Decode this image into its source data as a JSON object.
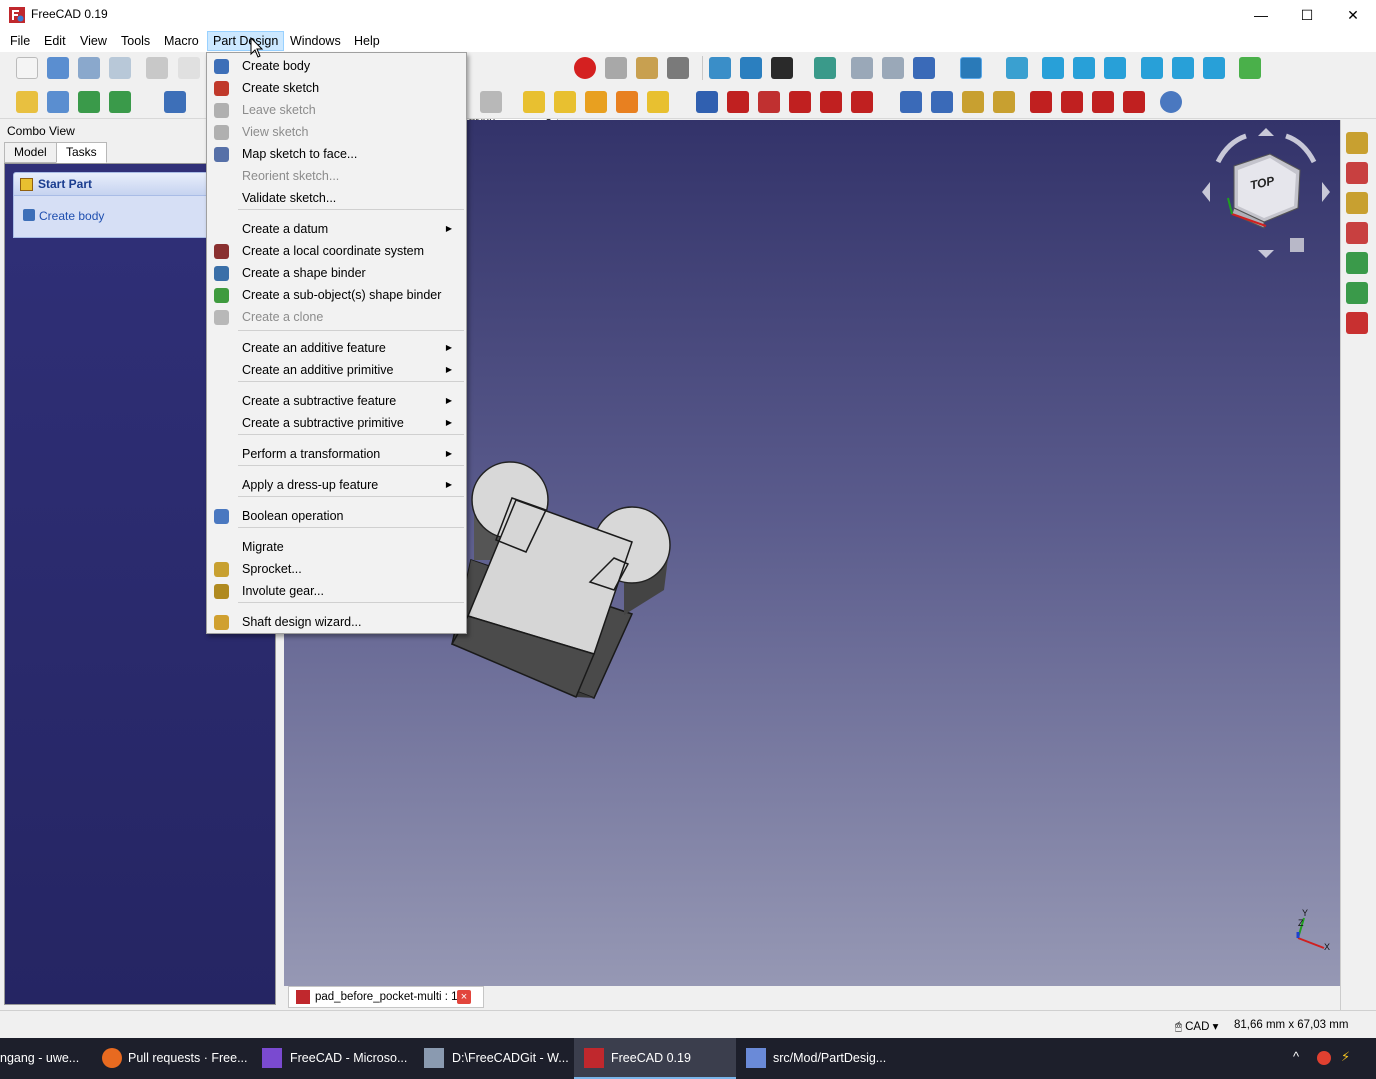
{
  "window": {
    "title": "FreeCAD 0.19"
  },
  "window_controls": {
    "minimize": "—",
    "maximize": "☐",
    "close": "✕"
  },
  "menubar": [
    "File",
    "Edit",
    "View",
    "Tools",
    "Macro",
    "Part Design",
    "Windows",
    "Help"
  ],
  "workbench_selector": {
    "value": "esign"
  },
  "combo_view": {
    "title": "Combo View",
    "tabs": [
      "Model",
      "Tasks"
    ],
    "task_box": {
      "title": "Start Part",
      "link": "Create body"
    }
  },
  "part_design_menu": {
    "items": [
      {
        "label": "Create body",
        "icon": "body-icon",
        "color": "#3d6fb8",
        "enabled": true,
        "submenu": false
      },
      {
        "label": "Create sketch",
        "icon": "sketch-icon",
        "color": "#c0392b",
        "enabled": true,
        "submenu": false
      },
      {
        "label": "Leave sketch",
        "icon": "leave-sketch-icon",
        "color": "#b0b0b0",
        "enabled": false,
        "submenu": false
      },
      {
        "label": "View sketch",
        "icon": "view-sketch-icon",
        "color": "#b0b0b0",
        "enabled": false,
        "submenu": false
      },
      {
        "label": "Map sketch to face...",
        "icon": "map-sketch-icon",
        "color": "#5670a8",
        "enabled": true,
        "submenu": false
      },
      {
        "label": "Reorient sketch...",
        "icon": "",
        "color": "",
        "enabled": false,
        "submenu": false
      },
      {
        "label": "Validate sketch...",
        "icon": "",
        "color": "",
        "enabled": true,
        "submenu": false
      },
      {
        "label": "Create a datum",
        "icon": "",
        "color": "",
        "enabled": true,
        "submenu": true
      },
      {
        "label": "Create a local coordinate system",
        "icon": "coordinate-system-icon",
        "color": "#8a3030",
        "enabled": true,
        "submenu": false
      },
      {
        "label": "Create a shape binder",
        "icon": "shape-binder-icon",
        "color": "#3a6fa8",
        "enabled": true,
        "submenu": false
      },
      {
        "label": "Create a sub-object(s) shape binder",
        "icon": "subshape-binder-icon",
        "color": "#3f9b3f",
        "enabled": true,
        "submenu": false
      },
      {
        "label": "Create a clone",
        "icon": "clone-icon",
        "color": "#b8b8b8",
        "enabled": false,
        "submenu": false
      },
      {
        "label": "Create an additive feature",
        "icon": "",
        "color": "",
        "enabled": true,
        "submenu": true
      },
      {
        "label": "Create an additive primitive",
        "icon": "",
        "color": "",
        "enabled": true,
        "submenu": true
      },
      {
        "label": "Create a subtractive feature",
        "icon": "",
        "color": "",
        "enabled": true,
        "submenu": true
      },
      {
        "label": "Create a subtractive primitive",
        "icon": "",
        "color": "",
        "enabled": true,
        "submenu": true
      },
      {
        "label": "Perform a transformation",
        "icon": "",
        "color": "",
        "enabled": true,
        "submenu": true
      },
      {
        "label": "Apply a dress-up feature",
        "icon": "",
        "color": "",
        "enabled": true,
        "submenu": true
      },
      {
        "label": "Boolean operation",
        "icon": "boolean-icon",
        "color": "#4a78c0",
        "enabled": true,
        "submenu": false
      },
      {
        "label": "Migrate",
        "icon": "",
        "color": "",
        "enabled": true,
        "submenu": false
      },
      {
        "label": "Sprocket...",
        "icon": "sprocket-icon",
        "color": "#c8a030",
        "enabled": true,
        "submenu": false
      },
      {
        "label": "Involute gear...",
        "icon": "gear-icon",
        "color": "#b08a20",
        "enabled": true,
        "submenu": false
      },
      {
        "label": "Shaft design wizard...",
        "icon": "shaft-icon",
        "color": "#d0a030",
        "enabled": true,
        "submenu": false
      }
    ]
  },
  "navigation_cube": {
    "face": "TOP"
  },
  "axis_labels": {
    "x": "X",
    "y": "Y",
    "z": "Z"
  },
  "document_tab": {
    "label": "pad_before_pocket-multi : 1",
    "close": "×"
  },
  "status_bar": {
    "nav_style": "CAD",
    "dimensions": "81,66 mm x 67,03 mm"
  },
  "taskbar": [
    {
      "label": "ngang - uwe...",
      "icon": "",
      "active": false
    },
    {
      "label": "Pull requests · Free...",
      "icon": "firefox-icon",
      "active": false
    },
    {
      "label": "FreeCAD - Microso...",
      "icon": "visual-studio-icon",
      "active": false
    },
    {
      "label": "D:\\FreeCADGit - W...",
      "icon": "git-icon",
      "active": false
    },
    {
      "label": "FreeCAD 0.19",
      "icon": "freecad-icon",
      "active": true
    },
    {
      "label": "src/Mod/PartDesig...",
      "icon": "file-explorer-icon",
      "active": false
    }
  ],
  "colors": {
    "accent": "#cce8ff",
    "viewport_top": "#33336a",
    "viewport_bottom": "#9698b4",
    "tasks_panel": "#2b2b6c"
  }
}
